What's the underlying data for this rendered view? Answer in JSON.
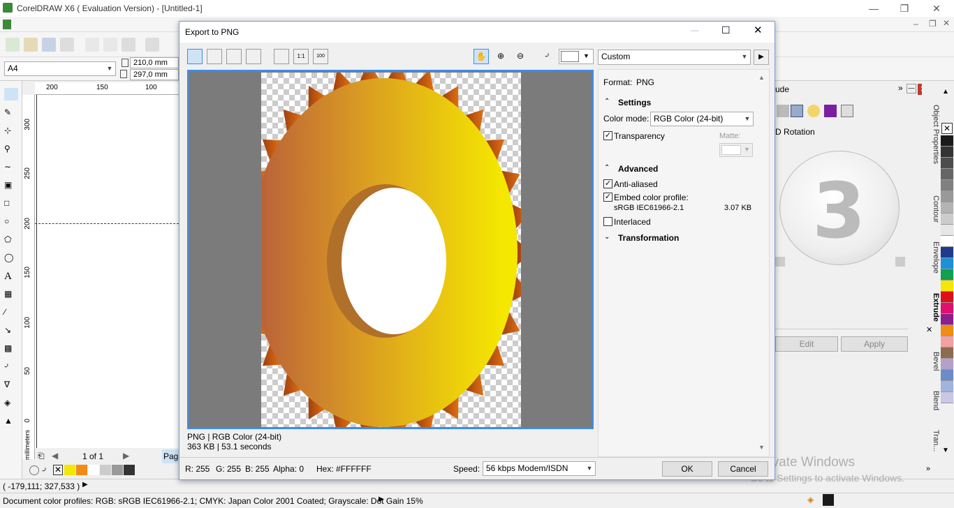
{
  "app": {
    "title": "CorelDRAW X6 ( Evaluation Version) - [Untitled-1]"
  },
  "propbar": {
    "page_size": "A4",
    "width": "210,0 mm",
    "height": "297,0 mm"
  },
  "ruler": {
    "h_ticks": [
      "200",
      "150",
      "100"
    ],
    "v_ticks": [
      "300",
      "250",
      "200",
      "150",
      "100",
      "50",
      "0"
    ],
    "unit": "millimeters"
  },
  "page_nav": {
    "page": "1 of 1",
    "tab": "Pag"
  },
  "status": {
    "coords": "( -179,111; 327,533 )",
    "profiles": "Document color profiles: RGB: sRGB IEC61966-2.1; CMYK: Japan Color 2001 Coated; Grayscale: Dot Gain 15%"
  },
  "dialog": {
    "title": "Export to PNG",
    "preset": "Custom",
    "preview_info": {
      "line1": "PNG  |  RGB Color (24-bit)",
      "line2": "363 KB  |  53.1 seconds"
    },
    "format_label": "Format:",
    "format_value": "PNG",
    "settings_heading": "Settings",
    "color_mode_label": "Color mode:",
    "color_mode_value": "RGB Color (24-bit)",
    "transparency_label": "Transparency",
    "matte_label": "Matte:",
    "advanced_heading": "Advanced",
    "anti_aliased_label": "Anti-aliased",
    "embed_profile_label": "Embed color profile:",
    "profile_name": "sRGB IEC61966-2.1",
    "profile_size": "3.07 KB",
    "interlaced_label": "Interlaced",
    "transformation_heading": "Transformation",
    "pixel_info": {
      "r": "R: 255",
      "g": "G: 255",
      "b": "B: 255",
      "alpha": "Alpha: 0",
      "hex": "Hex: #FFFFFF"
    },
    "speed_label": "Speed:",
    "speed_value": "56 kbps Modem/ISDN",
    "ok": "OK",
    "cancel": "Cancel"
  },
  "docker": {
    "title": "ude",
    "rotation_label": "D Rotation",
    "edit": "Edit",
    "apply": "Apply"
  },
  "vtabs": [
    "Object Properties",
    "Contour",
    "Envelope",
    "Extrude",
    "Bevel",
    "Blend",
    "Tran..."
  ],
  "watermark": {
    "line1": "Activate Windows",
    "line2": "Go to Settings to activate Windows."
  },
  "palette_colors": [
    "#1a1a1a",
    "#333333",
    "#4d4d4d",
    "#666666",
    "#808080",
    "#999999",
    "#b3b3b3",
    "#cccccc",
    "#e6e6e6",
    "#ffffff",
    "#1f3b8c",
    "#1e90d8",
    "#10a050",
    "#f5e60a",
    "#e0101a",
    "#e0106e",
    "#8c1f8c",
    "#f08c14",
    "#f5a0a0",
    "#8c6c50",
    "#b4a0c8",
    "#6a8cc8",
    "#a0b4dc",
    "#c8c8e6"
  ],
  "bottom_swatches": [
    "#f5e60a",
    "#f08c14",
    "#ffffff",
    "#cccccc",
    "#999999",
    "#333333"
  ]
}
